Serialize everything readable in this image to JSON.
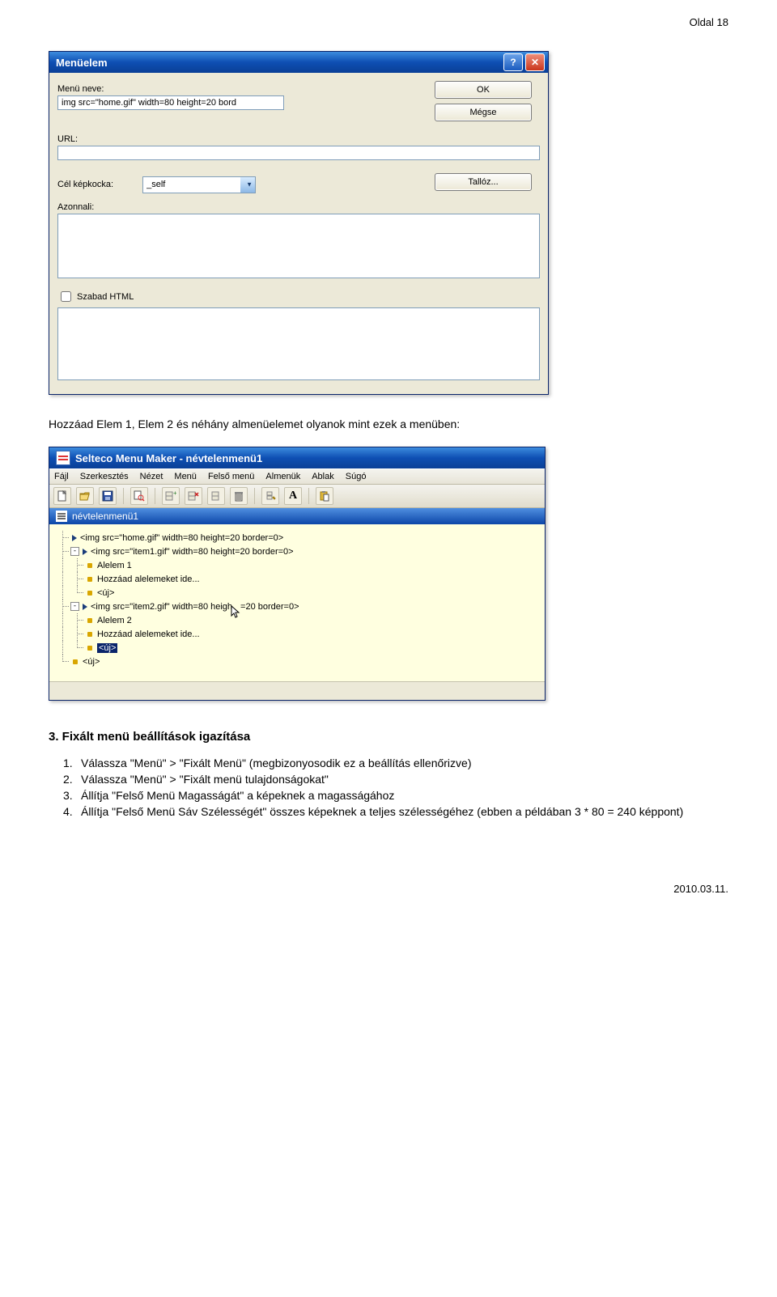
{
  "page_header": "Oldal  18",
  "page_footer": "2010.03.11.",
  "dialog": {
    "title": "Menüelem",
    "help_icon": "?",
    "close_icon": "✕",
    "labels": {
      "menu_name": "Menü neve:",
      "url": "URL:",
      "target_frame": "Cél képkocka:",
      "immediate": "Azonnali:",
      "free_html": "Szabad HTML"
    },
    "values": {
      "menu_name": "img src=\"home.gif\" width=80 height=20 bord",
      "url": "",
      "target_frame": "_self",
      "immediate": "",
      "free_html_checked": false,
      "html_area": ""
    },
    "buttons": {
      "ok": "OK",
      "cancel": "Mégse",
      "browse": "Tallóz..."
    }
  },
  "body_text_1": "Hozzáad Elem 1, Elem 2 és néhány almenüelemet olyanok mint ezek a menüben:",
  "app": {
    "title": "Selteco Menu Maker - névtelenmenü1",
    "menubar": [
      "Fájl",
      "Szerkesztés",
      "Nézet",
      "Menü",
      "Felső menü",
      "Almenük",
      "Ablak",
      "Súgó"
    ],
    "toolbar_icons": [
      "new",
      "open",
      "save",
      "preview",
      "add",
      "remove-x",
      "remove-item",
      "delete",
      "edit",
      "text",
      "paste"
    ],
    "doc_title": "névtelenmenü1",
    "tree": [
      {
        "depth": 0,
        "expander": "",
        "type": "arrow",
        "label": "<img src=\"home.gif\" width=80 height=20 border=0>"
      },
      {
        "depth": 0,
        "expander": "-",
        "type": "arrow",
        "label": "<img src=\"item1.gif\" width=80 height=20 border=0>"
      },
      {
        "depth": 1,
        "expander": "",
        "type": "bullet",
        "label": "Alelem 1"
      },
      {
        "depth": 1,
        "expander": "",
        "type": "bullet",
        "label": "Hozzáad alelemeket ide..."
      },
      {
        "depth": 1,
        "expander": "",
        "type": "bullet",
        "label": "<új>"
      },
      {
        "depth": 0,
        "expander": "-",
        "type": "arrow",
        "label_pre": "<img src=\"item2.gif\" width=80 heigh",
        "label_post": "=20 border=0>",
        "cursor": true
      },
      {
        "depth": 1,
        "expander": "",
        "type": "bullet",
        "label": "Alelem 2"
      },
      {
        "depth": 1,
        "expander": "",
        "type": "bullet",
        "label": "Hozzáad alelemeket ide..."
      },
      {
        "depth": 1,
        "expander": "",
        "type": "bullet",
        "label": "<új>",
        "selected": true
      },
      {
        "depth": 0,
        "expander": "",
        "type": "bullet",
        "label": "<új>"
      }
    ]
  },
  "section_heading": "3. Fixált menü beállítások igazítása",
  "steps": {
    "s1": "Válassza \"Menü\" > \"Fixált Menü\" (megbizonyosodik ez a beállítás ellenőrizve)",
    "s2": "Válassza \"Menü\" > \"Fixált menü tulajdonságokat\"",
    "s3": "Állítja \"Felső Menü Magasságát\" a képeknek a magasságához",
    "s4": "Állítja \"Felső Menü Sáv Szélességét\" összes képeknek a teljes szélességéhez (ebben a példában 3 * 80 = 240 képpont)"
  }
}
